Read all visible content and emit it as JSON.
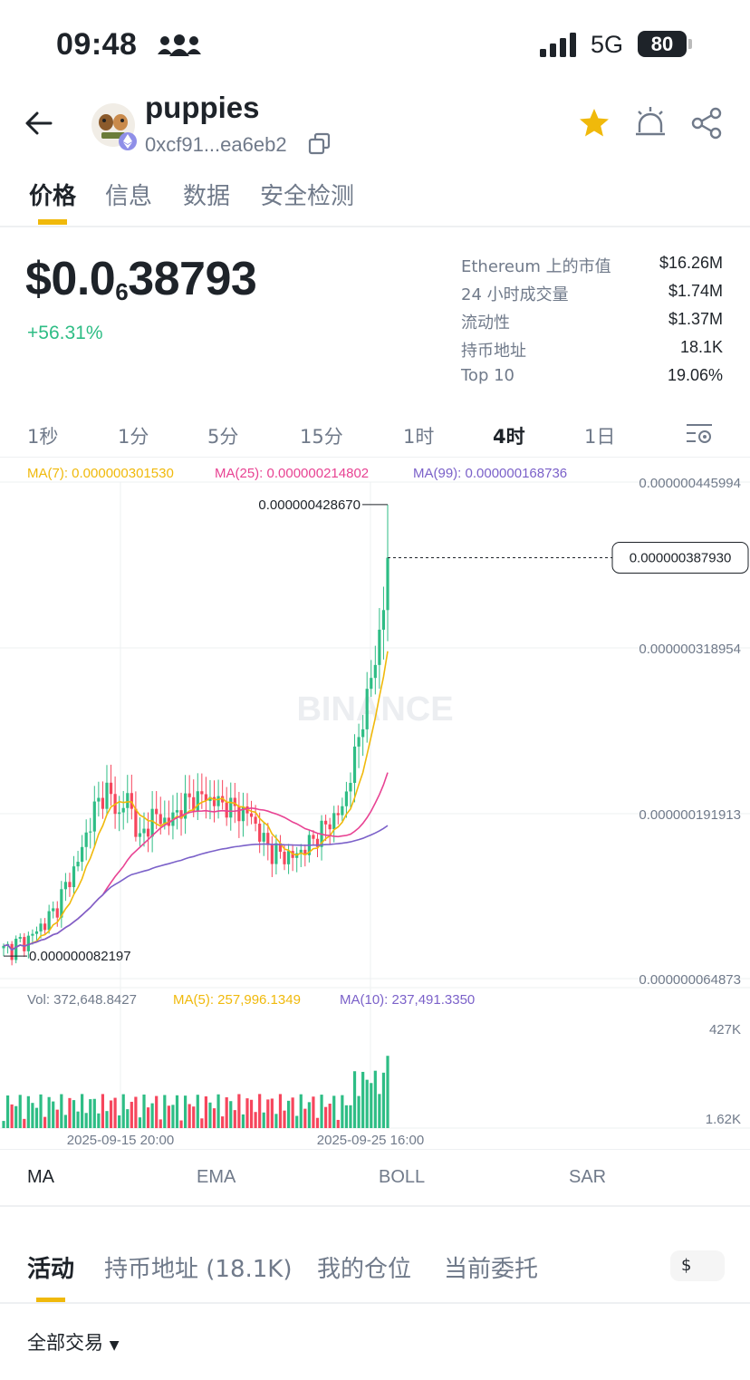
{
  "status_bar": {
    "time": "09:48",
    "network": "5G",
    "battery": "80"
  },
  "header": {
    "token_name": "puppies",
    "address": "0xcf91...ea6eb2",
    "icons": [
      "back-arrow-icon",
      "ethereum-icon",
      "copy-icon",
      "star-icon",
      "alert-icon",
      "share-icon"
    ]
  },
  "tabs": [
    {
      "label": "价格",
      "active": true
    },
    {
      "label": "信息",
      "active": false
    },
    {
      "label": "数据",
      "active": false
    },
    {
      "label": "安全检测",
      "active": false
    }
  ],
  "price": {
    "main": "$0.0",
    "subscript": "6",
    "digits": "38793",
    "change": "+56.31%"
  },
  "stats": [
    {
      "label": "Ethereum 上的市值",
      "value": "$16.26M"
    },
    {
      "label": "24 小时成交量",
      "value": "$1.74M"
    },
    {
      "label": "流动性",
      "value": "$1.37M"
    },
    {
      "label": "持币地址",
      "value": "18.1K"
    },
    {
      "label": "Top 10",
      "value": "19.06%"
    }
  ],
  "intervals": [
    {
      "label": "1秒",
      "active": false
    },
    {
      "label": "1分",
      "active": false
    },
    {
      "label": "5分",
      "active": false
    },
    {
      "label": "15分",
      "active": false
    },
    {
      "label": "1时",
      "active": false
    },
    {
      "label": "4时",
      "active": true
    },
    {
      "label": "1日",
      "active": false
    }
  ],
  "ma_legend": [
    {
      "text": "MA(7): 0.000000301530",
      "color": "#f0b90b"
    },
    {
      "text": "MA(25): 0.000000214802",
      "color": "#e84393"
    },
    {
      "text": "MA(99): 0.000000168736",
      "color": "#7b61c9"
    }
  ],
  "vol_legend": [
    {
      "text": "Vol: 372,648.8427",
      "color": "#707a8a"
    },
    {
      "text": "MA(5): 257,996.1349",
      "color": "#f0b90b"
    },
    {
      "text": "MA(10): 237,491.3350",
      "color": "#7b61c9"
    }
  ],
  "chart_data": {
    "type": "candlestick",
    "watermark": "BINANCE",
    "y_axis_labels": [
      "0.000000445994",
      "0.000000318954",
      "0.000000191913",
      "0.000000064873"
    ],
    "ylim": [
      6.4873e-08,
      4.45994e-07
    ],
    "current_price_label": "0.000000387930",
    "current_price": 3.8793e-07,
    "high_label": "0.000000428670",
    "high": 4.2867e-07,
    "low_label": "0.000000082197",
    "low": 8.2197e-08,
    "x_axis_labels": [
      "2025-09-15 20:00",
      "2025-09-25 16:00"
    ],
    "volume_axis_labels": [
      "427K",
      "1.62K"
    ],
    "volume_max": 427000,
    "colors": {
      "up": "#2ebd85",
      "down": "#f6465d",
      "ma7": "#f0b90b",
      "ma25": "#e84393",
      "ma99": "#7b61c9"
    }
  },
  "indicator_tabs": [
    {
      "label": "MA",
      "active": true
    },
    {
      "label": "EMA",
      "active": false
    },
    {
      "label": "BOLL",
      "active": false
    },
    {
      "label": "SAR",
      "active": false
    }
  ],
  "bottom_tabs": [
    {
      "label": "活动",
      "active": true
    },
    {
      "label": "持币地址 (18.1K)",
      "active": false
    },
    {
      "label": "我的仓位",
      "active": false
    },
    {
      "label": "当前委托",
      "active": false
    }
  ],
  "currency_toggle": "$",
  "filter_label": "全部交易"
}
